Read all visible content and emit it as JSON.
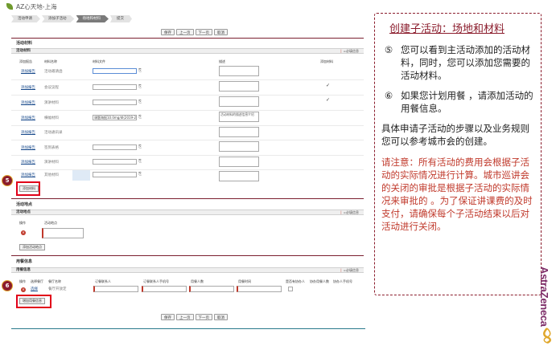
{
  "header": {
    "title": "AZ心天地-上海"
  },
  "steps": [
    "活动申请",
    "添加子活动",
    "场地和材料",
    "提交"
  ],
  "toolbar": {
    "buttons": [
      "保存",
      "上一页",
      "下一页",
      "取消"
    ]
  },
  "materials": {
    "section_title": "活动材料",
    "sub_title": "活动材料",
    "required_label": "=必填信息",
    "columns": [
      "添加报告",
      "材料名称",
      "材料文件",
      "",
      "描述",
      "添加材料"
    ],
    "rows": [
      {
        "action": "添加报告",
        "name": "活动邀请函",
        "file": "",
        "desc": "",
        "checked": ""
      },
      {
        "action": "添加报告",
        "name": "会议议程",
        "file": "",
        "desc": "",
        "checked": "✓"
      },
      {
        "action": "添加报告",
        "name": "演讲材料",
        "file": "",
        "desc": "",
        "checked": "✓"
      },
      {
        "action": "添加报告",
        "name": "横幅材料",
        "file": "课题海报10.0mg/dl(2019-201",
        "desc": "活动材料的描述信息介绍",
        "checked": ""
      },
      {
        "action": "添加报告",
        "name": "活动通讯录",
        "file": "",
        "desc": "",
        "checked": ""
      },
      {
        "action": "添加报告",
        "name": "签到表格",
        "file": "",
        "desc": "",
        "checked": ""
      },
      {
        "action": "添加报告",
        "name": "演讲材料",
        "file": "",
        "desc": "",
        "checked": ""
      },
      {
        "action": "添加报告",
        "name": "其他材料",
        "file": "",
        "desc": "",
        "checked": ""
      }
    ],
    "add_button": "添加材料"
  },
  "venue": {
    "section_title": "活动地点",
    "sub_title": "活动地点",
    "required_label": "=必填信息",
    "columns": [
      "操作",
      "活动地点"
    ],
    "add_button": "添加活动地点"
  },
  "catering": {
    "section_title": "用餐信息",
    "sub_title": "用餐信息",
    "required_label": "=必填信息",
    "columns": [
      "操作",
      "选择餐厅",
      "餐厅名称",
      "订餐联系人",
      "订餐联系人手机号",
      "用餐人数",
      "用餐时间",
      "是否有协办人",
      "协办用餐人数",
      "协办人手机号"
    ],
    "row": {
      "select": "选择",
      "restaurant": "餐厅开放定"
    },
    "add_button": "增加用餐信息"
  },
  "callouts": {
    "title": "创建子活动：场地和材料",
    "items": [
      {
        "num": "⑤",
        "text": "您可以看到主活动添加的活动材料，同时，您可以添加您需要的活动材料。"
      },
      {
        "num": "⑥",
        "text": "如果您计划用餐 ，请添加活动的用餐信息。"
      }
    ],
    "plain": "具体申请子活动的步骤以及业务规则您可以参考城市会的创建。",
    "note": "请注意：所有活动的费用会根据子活动的实际情况进行计算。城市巡讲会的关闭的审批是根据子活动的实际情况来审批的 。为了保证讲课费的及时支付，请确保每个子活动结束以后对活动进行关闭。"
  },
  "markers": {
    "five": "5",
    "six": "6"
  },
  "brand": {
    "name": "AstraZeneca"
  },
  "colors": {
    "accent": "#8b1c2c",
    "highlight": "#e10019",
    "brand": "#7b2a66"
  }
}
